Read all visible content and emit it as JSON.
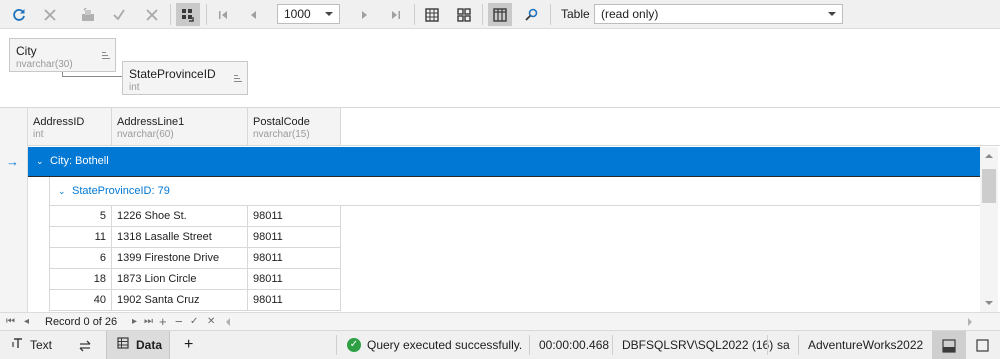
{
  "toolbar": {
    "page_size": "1000",
    "table_label": "Table",
    "table_mode": "(read only)"
  },
  "group_panel": {
    "chips": [
      {
        "name": "City",
        "type": "nvarchar(30)"
      },
      {
        "name": "StateProvinceID",
        "type": "int"
      }
    ]
  },
  "grid": {
    "columns": [
      {
        "name": "AddressID",
        "type": "int"
      },
      {
        "name": "AddressLine1",
        "type": "nvarchar(60)"
      },
      {
        "name": "PostalCode",
        "type": "nvarchar(15)"
      }
    ],
    "group1": "City: Bothell",
    "group2": "StateProvinceID: 79",
    "rows": [
      {
        "id": "5",
        "line": "1226 Shoe St.",
        "postal": "98011"
      },
      {
        "id": "11",
        "line": "1318 Lasalle Street",
        "postal": "98011"
      },
      {
        "id": "6",
        "line": "1399 Firestone Drive",
        "postal": "98011"
      },
      {
        "id": "18",
        "line": "1873 Lion Circle",
        "postal": "98011"
      },
      {
        "id": "40",
        "line": "1902 Santa Cruz",
        "postal": "98011"
      }
    ]
  },
  "navigator": {
    "record": "Record 0 of 26"
  },
  "statusbar": {
    "text_tab": "Text",
    "data_tab": "Data",
    "message": "Query executed successfully.",
    "elapsed": "00:00:00.468",
    "server": "DBFSQLSRV\\SQL2022 (16)",
    "user": "sa",
    "database": "AdventureWorks2022"
  },
  "colors": {
    "accent": "#0078d4",
    "success": "#2ea043"
  },
  "icons": {
    "toolbar": [
      "refresh-icon",
      "cancel-icon",
      "save-icon",
      "check-icon",
      "close-icon",
      "grid-layout-icon",
      "first-page-icon",
      "prev-page-icon",
      "next-page-icon",
      "last-page-icon",
      "grid-icon",
      "card-view-icon",
      "columns-icon",
      "find-icon"
    ],
    "status": [
      "text-icon",
      "swap-icon",
      "data-grid-icon",
      "add-icon",
      "success-icon",
      "panel-bottom-icon",
      "panel-icon"
    ]
  }
}
